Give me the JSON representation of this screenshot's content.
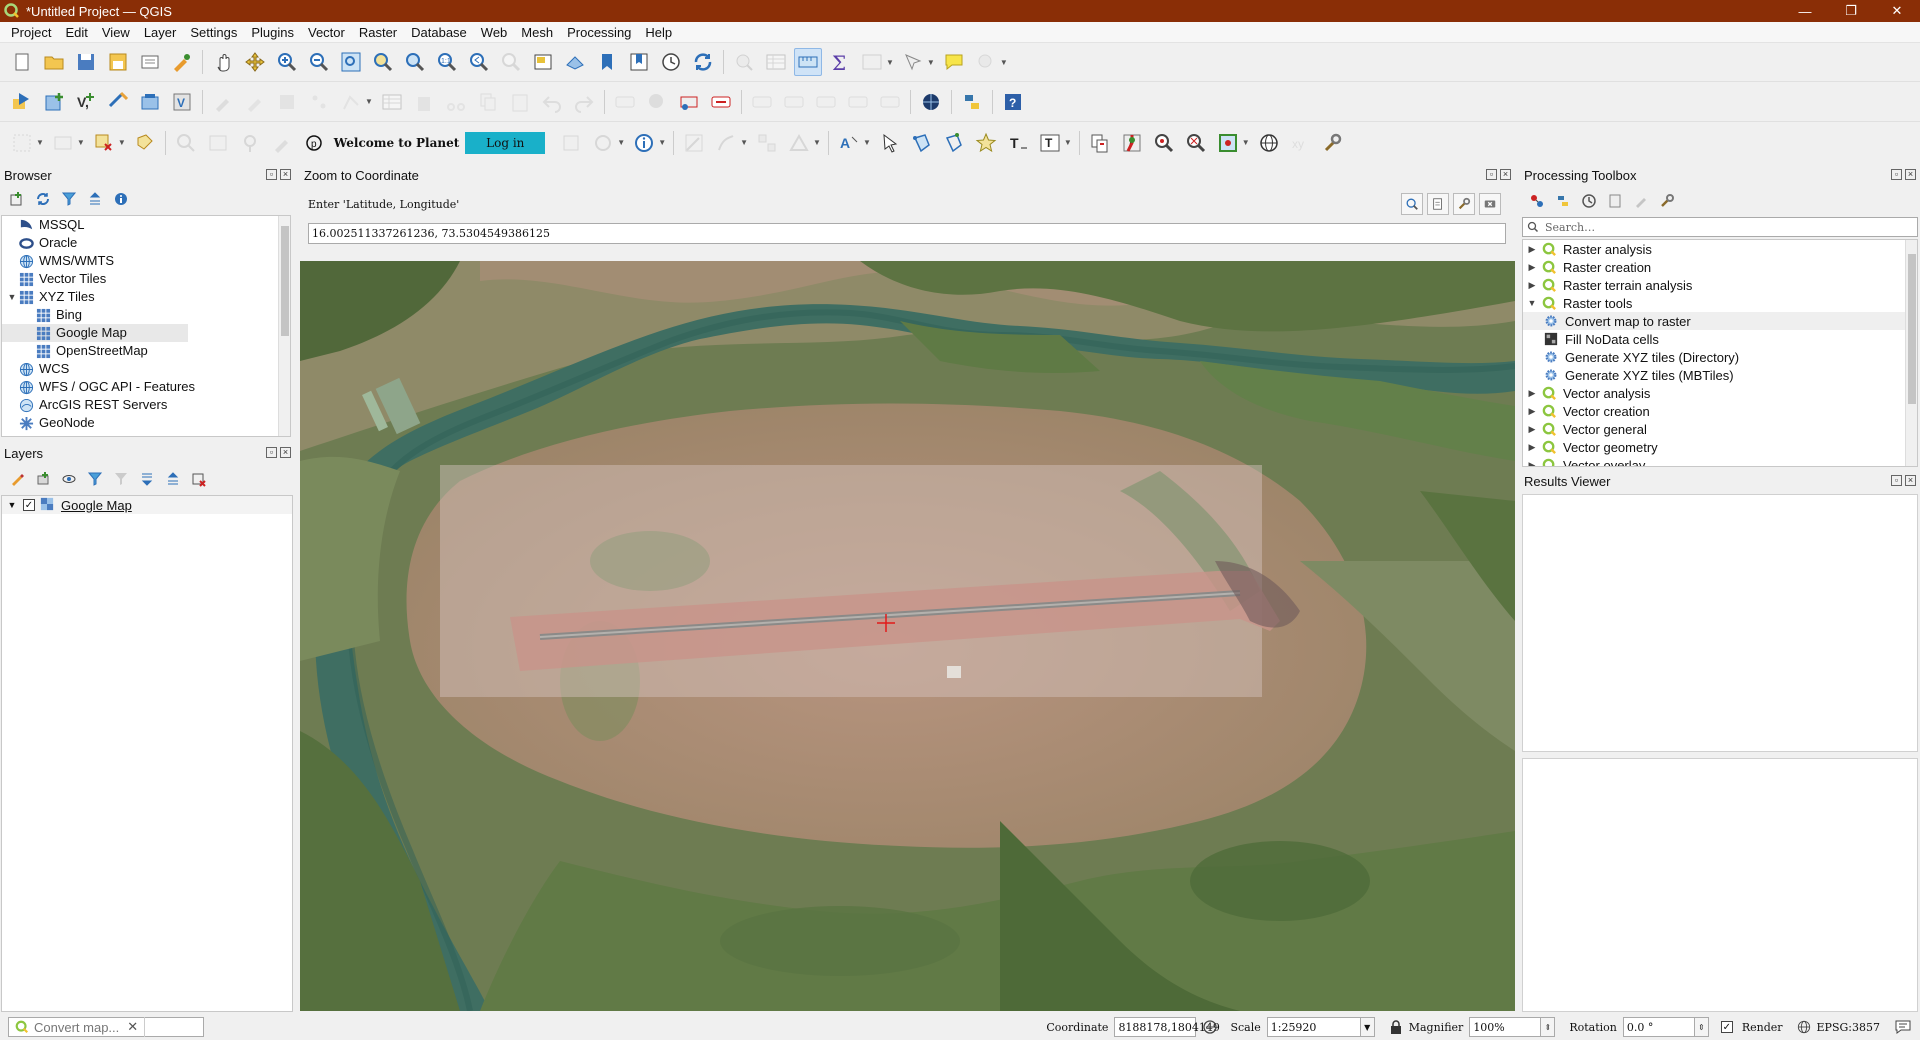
{
  "window": {
    "title": "*Untitled Project — QGIS",
    "minimize": "—",
    "restore": "❐",
    "close": "✕"
  },
  "menu": [
    "Project",
    "Edit",
    "View",
    "Layer",
    "Settings",
    "Plugins",
    "Vector",
    "Raster",
    "Database",
    "Web",
    "Mesh",
    "Processing",
    "Help"
  ],
  "planet": {
    "welcome": "Welcome to Planet",
    "login": "Log in"
  },
  "browser": {
    "title": "Browser",
    "items": [
      {
        "label": "MSSQL",
        "icon": "mssql-icon",
        "indent": 0,
        "arrow": ""
      },
      {
        "label": "Oracle",
        "icon": "oracle-icon",
        "indent": 0,
        "arrow": ""
      },
      {
        "label": "WMS/WMTS",
        "icon": "globe-icon",
        "indent": 0,
        "arrow": ""
      },
      {
        "label": "Vector Tiles",
        "icon": "grid-icon",
        "indent": 0,
        "arrow": ""
      },
      {
        "label": "XYZ Tiles",
        "icon": "grid-icon",
        "indent": 0,
        "arrow": "▼"
      },
      {
        "label": "Bing",
        "icon": "grid-icon",
        "indent": 1,
        "arrow": ""
      },
      {
        "label": "Google Map",
        "icon": "grid-icon",
        "indent": 1,
        "arrow": "",
        "selected": true
      },
      {
        "label": "OpenStreetMap",
        "icon": "grid-icon",
        "indent": 1,
        "arrow": ""
      },
      {
        "label": "WCS",
        "icon": "globe-icon",
        "indent": 0,
        "arrow": ""
      },
      {
        "label": "WFS / OGC API - Features",
        "icon": "globe-icon",
        "indent": 0,
        "arrow": ""
      },
      {
        "label": "ArcGIS REST Servers",
        "icon": "arcgis-icon",
        "indent": 0,
        "arrow": ""
      },
      {
        "label": "GeoNode",
        "icon": "geonode-icon",
        "indent": 0,
        "arrow": ""
      }
    ]
  },
  "layers": {
    "title": "Layers",
    "items": [
      {
        "label": "Google Map",
        "checked": "✓",
        "arrow": "▼"
      }
    ]
  },
  "zoom_coord": {
    "title": "Zoom to Coordinate",
    "label": "Enter 'Latitude, Longitude'",
    "value": "16.002511337261236, 73.5304549386125"
  },
  "toolbox": {
    "title": "Processing Toolbox",
    "search_placeholder": "Search…",
    "items": [
      {
        "label": "Raster analysis",
        "type": "group",
        "arrow": "▶"
      },
      {
        "label": "Raster creation",
        "type": "group",
        "arrow": "▶"
      },
      {
        "label": "Raster terrain analysis",
        "type": "group",
        "arrow": "▶"
      },
      {
        "label": "Raster tools",
        "type": "group",
        "arrow": "▼"
      },
      {
        "label": "Convert map to raster",
        "type": "alg",
        "icon": "gear-icon",
        "highlight": true
      },
      {
        "label": "Fill NoData cells",
        "type": "alg",
        "icon": "raster-icon"
      },
      {
        "label": "Generate XYZ tiles (Directory)",
        "type": "alg",
        "icon": "gear-icon"
      },
      {
        "label": "Generate XYZ tiles (MBTiles)",
        "type": "alg",
        "icon": "gear-icon"
      },
      {
        "label": "Vector analysis",
        "type": "group",
        "arrow": "▶"
      },
      {
        "label": "Vector creation",
        "type": "group",
        "arrow": "▶"
      },
      {
        "label": "Vector general",
        "type": "group",
        "arrow": "▶"
      },
      {
        "label": "Vector geometry",
        "type": "group",
        "arrow": "▶"
      },
      {
        "label": "Vector overlay",
        "type": "group",
        "arrow": "▶"
      }
    ]
  },
  "results": {
    "title": "Results Viewer"
  },
  "status": {
    "locator_text": "Convert map...",
    "coordinate_label": "Coordinate",
    "coordinate_value": "8188178,1804149",
    "scale_label": "Scale",
    "scale_value": "1:25920",
    "magnifier_label": "Magnifier",
    "magnifier_value": "100%",
    "rotation_label": "Rotation",
    "rotation_value": "0.0 °",
    "render_label": "Render",
    "crs": "EPSG:3857"
  },
  "colors": {
    "titlebar": "#8a2e06",
    "accent": "#589632",
    "login": "#19b0c9"
  }
}
